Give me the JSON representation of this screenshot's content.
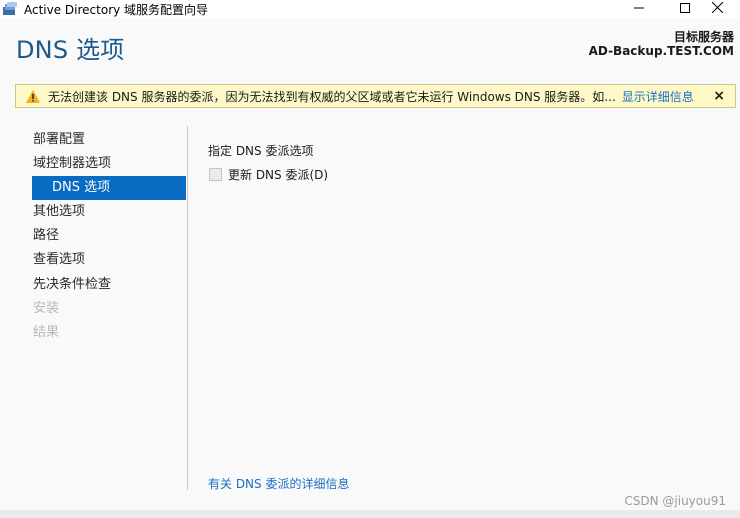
{
  "window": {
    "title": "Active Directory 域服务配置向导",
    "icon": "server-wizard-icon",
    "controls": {
      "minimize_icon": "minimize-icon",
      "maximize_icon": "maximize-icon",
      "close_icon": "close-icon"
    }
  },
  "header": {
    "page_title": "DNS 选项",
    "target_server_label": "目标服务器",
    "target_server_name": "AD-Backup.TEST.COM"
  },
  "warning": {
    "icon": "warning-triangle-icon",
    "text": "无法创建该 DNS 服务器的委派，因为无法找到有权威的父区域或者它未运行 Windows DNS 服务器。如...",
    "details_link": "显示详细信息",
    "close_glyph": "×",
    "background_color": "#fdf8c8"
  },
  "nav": {
    "items": [
      {
        "label": "部署配置",
        "state": "normal"
      },
      {
        "label": "域控制器选项",
        "state": "normal"
      },
      {
        "label": "DNS 选项",
        "state": "selected"
      },
      {
        "label": "其他选项",
        "state": "normal"
      },
      {
        "label": "路径",
        "state": "normal"
      },
      {
        "label": "查看选项",
        "state": "normal"
      },
      {
        "label": "先决条件检查",
        "state": "normal"
      },
      {
        "label": "安装",
        "state": "disabled"
      },
      {
        "label": "结果",
        "state": "disabled"
      }
    ],
    "selected_color": "#0a6bc2"
  },
  "main": {
    "section_label": "指定 DNS 委派选项",
    "checkbox": {
      "label": "更新 DNS 委派(D)",
      "checked": false,
      "enabled": false
    },
    "more_info_link": "有关 DNS 委派的详细信息"
  },
  "watermark": "CSDN @jiuyou91",
  "colors": {
    "title_blue": "#1c5a8c",
    "link_blue": "#1a6fc4"
  }
}
